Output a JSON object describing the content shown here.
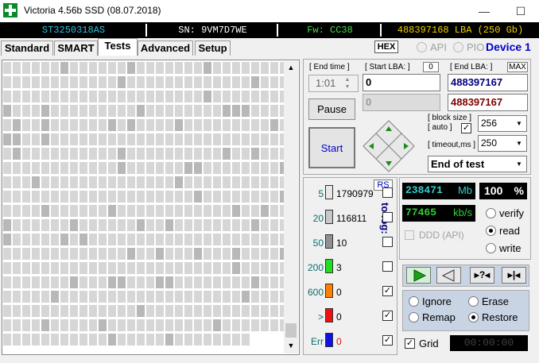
{
  "window": {
    "title": "Victoria 4.56b SSD (08.07.2018)",
    "minimize": "—",
    "maximize": "☐"
  },
  "infobar": {
    "model": "ST3250318AS",
    "serial": "SN: 9VM7D7WE",
    "firmware": "Fw: CC38",
    "capacity": "488397168 LBA (250 Gb)"
  },
  "tabs": [
    "Standard",
    "SMART",
    "Tests",
    "Advanced",
    "Setup"
  ],
  "active_tab": "Tests",
  "hex_label": "HEX",
  "api_label": "API",
  "pio_label": "PIO",
  "device_label": "Device 1",
  "end_time": {
    "label": "[ End time ]",
    "value": "1:01"
  },
  "start_lba": {
    "label": "[ Start LBA: ]",
    "value": "0",
    "current": "0",
    "counter": "0"
  },
  "end_lba": {
    "label": "[ End LBA: ]",
    "max_label": "MAX",
    "value": "488397167",
    "current": "488397167"
  },
  "pause_label": "Pause",
  "start_label": "Start",
  "block_size": {
    "label1": "[ block size ]",
    "label2": "[ auto ]",
    "value": "256"
  },
  "timeout": {
    "label": "[ timeout,ms ]",
    "value": "250"
  },
  "end_action": "End of test",
  "rs_label": "RS",
  "to_log_label": "to log:",
  "legend": [
    {
      "threshold": "5",
      "count": "1790979",
      "color": "#e8e8e8",
      "log": false
    },
    {
      "threshold": "20",
      "count": "116811",
      "color": "#c8c8c8",
      "log": false
    },
    {
      "threshold": "50",
      "count": "10",
      "color": "#909090",
      "log": false
    },
    {
      "threshold": "200",
      "count": "3",
      "color": "#22dd22",
      "log": false
    },
    {
      "threshold": "600",
      "count": "0",
      "color": "#ff8000",
      "log": true
    },
    {
      "threshold": ">",
      "count": "0",
      "color": "#ee1111",
      "log": true
    },
    {
      "threshold": "Err",
      "count": "0",
      "color": "#1010e0",
      "log": true
    }
  ],
  "progress": {
    "mb": "238471",
    "mb_unit": "Mb",
    "percent": "100",
    "percent_unit": "%",
    "speed": "77465",
    "speed_unit": "kb/s"
  },
  "modes": [
    "verify",
    "read",
    "write"
  ],
  "selected_mode": "read",
  "ddd_label": "DDD (API)",
  "actions": [
    "Ignore",
    "Erase",
    "Remap",
    "Restore"
  ],
  "selected_action": "Restore",
  "grid_label": "Grid",
  "timer": "00:00:00",
  "colors": {
    "accent": "#0000d0",
    "mb_text": "#30d0d0",
    "speed_text": "#30d030",
    "panel_blue": "#c8d4e4"
  }
}
